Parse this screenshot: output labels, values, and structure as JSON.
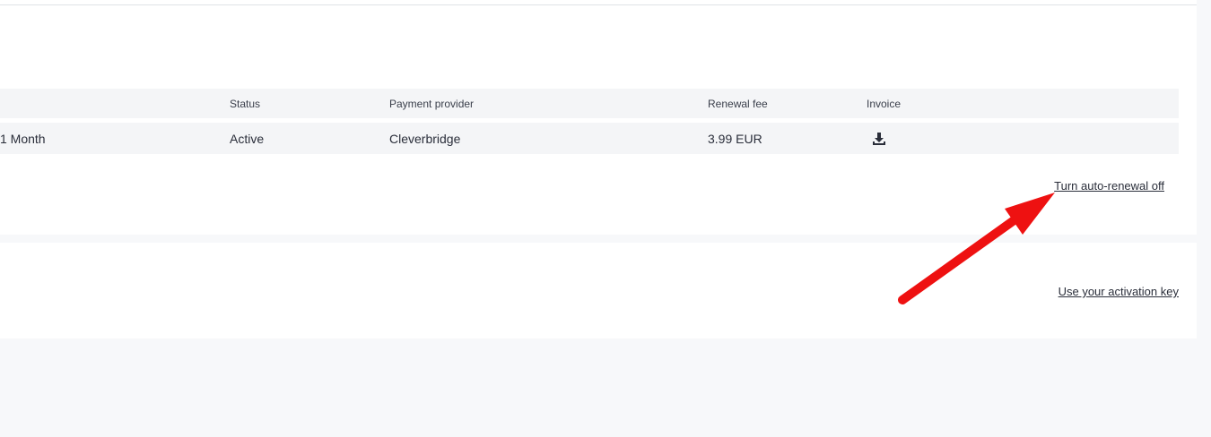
{
  "subscription_table": {
    "headers": {
      "plan": "",
      "status": "Status",
      "payment_provider": "Payment provider",
      "renewal_fee": "Renewal fee",
      "invoice": "Invoice"
    },
    "rows": [
      {
        "plan": "1 Month",
        "status": "Active",
        "payment_provider": "Cleverbridge",
        "renewal_fee": "3.99 EUR",
        "invoice_icon": "download-icon"
      }
    ]
  },
  "actions": {
    "turn_auto_renewal_off": "Turn auto-renewal off",
    "use_activation_key": "Use your activation key"
  },
  "annotation": {
    "arrow_color": "#ee1111"
  },
  "colors": {
    "page_background": "#f7f8fa",
    "card_background": "#ffffff",
    "table_row_background": "#f4f5f7",
    "text": "#2a2e3a"
  }
}
